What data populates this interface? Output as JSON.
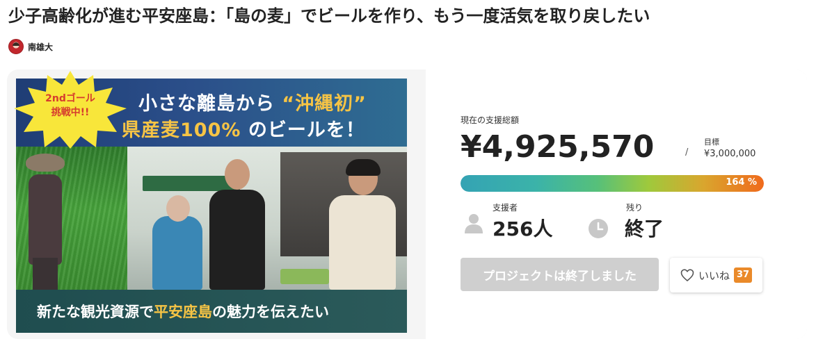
{
  "page": {
    "title": "少子高齢化が進む平安座島：「島の麦」でビールを作り、もう一度活気を取り戻したい"
  },
  "author": {
    "name": "南雄大"
  },
  "hero": {
    "badge_line1": "2ndゴール",
    "badge_line2": "挑戦中!!",
    "top_line1_pre": "小さな離島から",
    "top_line1_highlight": "“沖縄初”",
    "top_line2_highlight": "県産麦100%",
    "top_line2_post": "のビールを！",
    "bottom_pre": "新たな観光資源で",
    "bottom_highlight": "平安座島",
    "bottom_post": "の魅力を伝えたい"
  },
  "funding": {
    "total_label": "現在の支援総額",
    "total_amount": "¥4,925,570",
    "separator": "/",
    "goal_label": "目標",
    "goal_amount": "¥3,000,000",
    "progress_label": "164 %",
    "progress_fraction": 1.0
  },
  "stats": {
    "backers_label": "支援者",
    "backers_value": "256人",
    "remaining_label": "残り",
    "remaining_value": "終了"
  },
  "actions": {
    "ended_button": "プロジェクトは終了しました",
    "like_label": "いいね",
    "like_count": "37"
  },
  "icons": {
    "backers": "user-icon",
    "remaining": "clock-icon",
    "like": "heart-icon"
  },
  "colors": {
    "highlight": "#f6c445",
    "badge": "#f8e63a",
    "badge_text": "#d63b2e",
    "like_badge": "#ea8a2a",
    "progress_start": "#34a3b4",
    "progress_end": "#f06a1c",
    "disabled_button": "#cfcfcf"
  }
}
